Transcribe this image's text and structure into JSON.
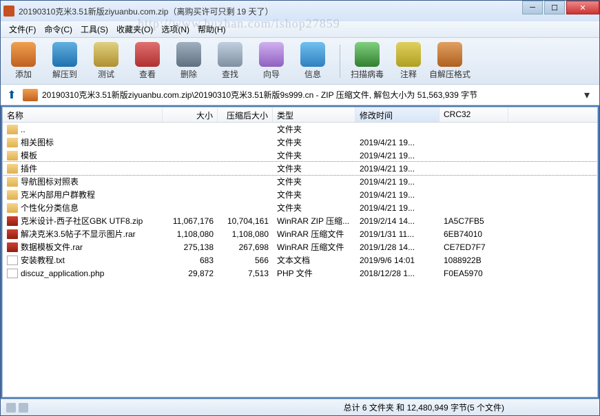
{
  "title": "20190310克米3.51新版ziyuanbu.com.zip（离购买许可只剩 19 天了）",
  "menu": {
    "file": "文件(F)",
    "command": "命令(C)",
    "tools": "工具(S)",
    "favorites": "收藏夹(O)",
    "options": "选项(N)",
    "help": "帮助(H)"
  },
  "watermark": "http://www.huzhan.com/ishop27859",
  "toolbar": {
    "add": "添加",
    "extract": "解压到",
    "test": "测试",
    "view": "查看",
    "delete": "删除",
    "find": "查找",
    "wizard": "向导",
    "info": "信息",
    "virus": "扫描病毒",
    "comment": "注释",
    "sfx": "自解压格式"
  },
  "path": "20190310克米3.51新版ziyuanbu.com.zip\\20190310克米3.51新版9s999.cn - ZIP 压缩文件, 解包大小为 51,563,939 字节",
  "columns": {
    "name": "名称",
    "size": "大小",
    "packed": "压缩后大小",
    "type": "类型",
    "date": "修改时间",
    "crc": "CRC32"
  },
  "rows": [
    {
      "icon": "folder",
      "name": "..",
      "size": "",
      "packed": "",
      "type": "文件夹",
      "date": "",
      "crc": "",
      "sel": false
    },
    {
      "icon": "folder",
      "name": "相关图标",
      "size": "",
      "packed": "",
      "type": "文件夹",
      "date": "2019/4/21 19...",
      "crc": "",
      "sel": false
    },
    {
      "icon": "folder",
      "name": "模板",
      "size": "",
      "packed": "",
      "type": "文件夹",
      "date": "2019/4/21 19...",
      "crc": "",
      "sel": false
    },
    {
      "icon": "folder",
      "name": "插件",
      "size": "",
      "packed": "",
      "type": "文件夹",
      "date": "2019/4/21 19...",
      "crc": "",
      "sel": true
    },
    {
      "icon": "folder",
      "name": "导航图标对照表",
      "size": "",
      "packed": "",
      "type": "文件夹",
      "date": "2019/4/21 19...",
      "crc": "",
      "sel": false
    },
    {
      "icon": "folder",
      "name": "克米内部用户群教程",
      "size": "",
      "packed": "",
      "type": "文件夹",
      "date": "2019/4/21 19...",
      "crc": "",
      "sel": false
    },
    {
      "icon": "folder",
      "name": "个性化分类信息",
      "size": "",
      "packed": "",
      "type": "文件夹",
      "date": "2019/4/21 19...",
      "crc": "",
      "sel": false
    },
    {
      "icon": "rar",
      "name": "克米设计-西子社区GBK UTF8.zip",
      "size": "11,067,176",
      "packed": "10,704,161",
      "type": "WinRAR ZIP 压缩...",
      "date": "2019/2/14 14...",
      "crc": "1A5C7FB5",
      "sel": false
    },
    {
      "icon": "rar",
      "name": "解决克米3.5帖子不显示图片.rar",
      "size": "1,108,080",
      "packed": "1,108,080",
      "type": "WinRAR 压缩文件",
      "date": "2019/1/31 11...",
      "crc": "6EB74010",
      "sel": false
    },
    {
      "icon": "rar",
      "name": "数据模板文件.rar",
      "size": "275,138",
      "packed": "267,698",
      "type": "WinRAR 压缩文件",
      "date": "2019/1/28 14...",
      "crc": "CE7ED7F7",
      "sel": false
    },
    {
      "icon": "txt",
      "name": "安装教程.txt",
      "size": "683",
      "packed": "566",
      "type": "文本文档",
      "date": "2019/9/6 14:01",
      "crc": "1088922B",
      "sel": false
    },
    {
      "icon": "php",
      "name": "discuz_application.php",
      "size": "29,872",
      "packed": "7,513",
      "type": "PHP 文件",
      "date": "2018/12/28 1...",
      "crc": "F0EA5970",
      "sel": false
    }
  ],
  "status": "总计 6 文件夹 和 12,480,949 字节(5 个文件)"
}
